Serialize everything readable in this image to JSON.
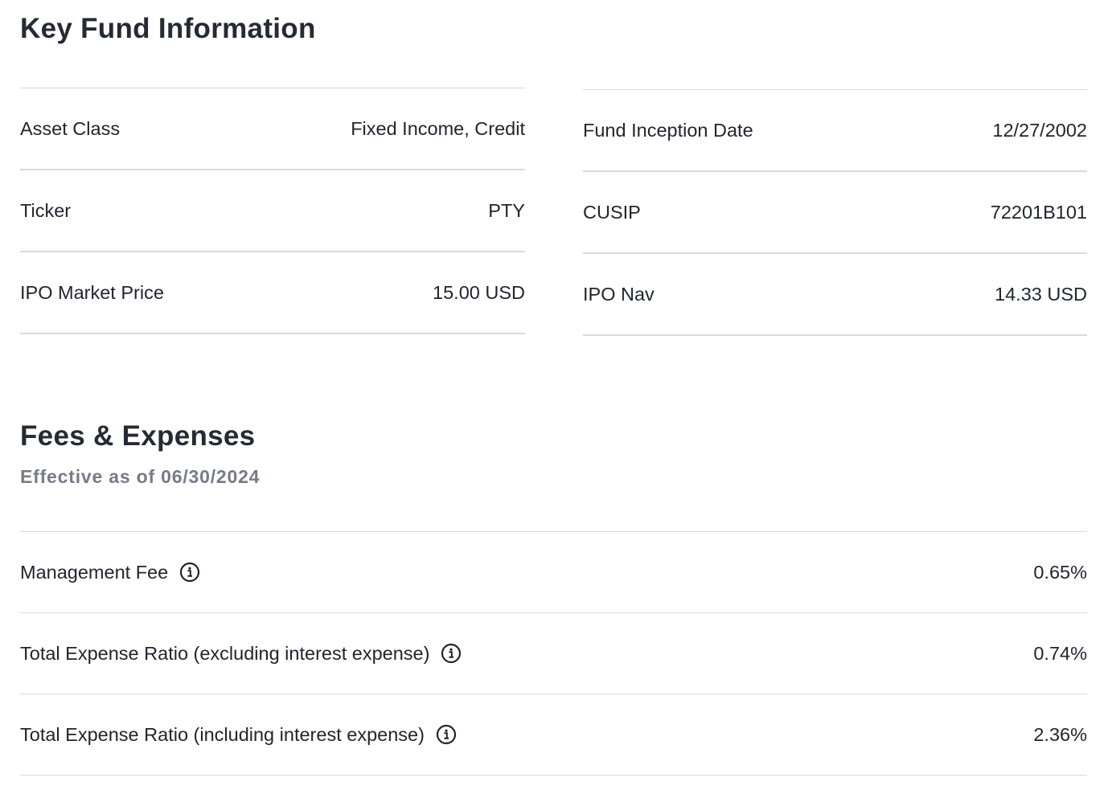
{
  "key_fund_info": {
    "title": "Key Fund Information",
    "left_rows": [
      {
        "label": "Asset Class",
        "value": "Fixed Income, Credit"
      },
      {
        "label": "Ticker",
        "value": "PTY"
      },
      {
        "label": "IPO Market Price",
        "value": "15.00 USD"
      }
    ],
    "right_rows": [
      {
        "label": "Fund Inception Date",
        "value": "12/27/2002"
      },
      {
        "label": "CUSIP",
        "value": "72201B101"
      },
      {
        "label": "IPO Nav",
        "value": "14.33 USD"
      }
    ]
  },
  "fees": {
    "title": "Fees & Expenses",
    "subtitle": "Effective as of 06/30/2024",
    "rows": [
      {
        "label": "Management Fee",
        "value": "0.65%",
        "icon": "info-icon"
      },
      {
        "label": "Total Expense Ratio (excluding interest expense)",
        "value": "0.74%",
        "icon": "info-icon"
      },
      {
        "label": "Total Expense Ratio (including interest expense)",
        "value": "2.36%",
        "icon": "info-icon"
      }
    ]
  },
  "colors": {
    "text": "#22252c",
    "heading": "#262a33",
    "subtitle": "#767b85",
    "divider": "#d9dadd"
  }
}
